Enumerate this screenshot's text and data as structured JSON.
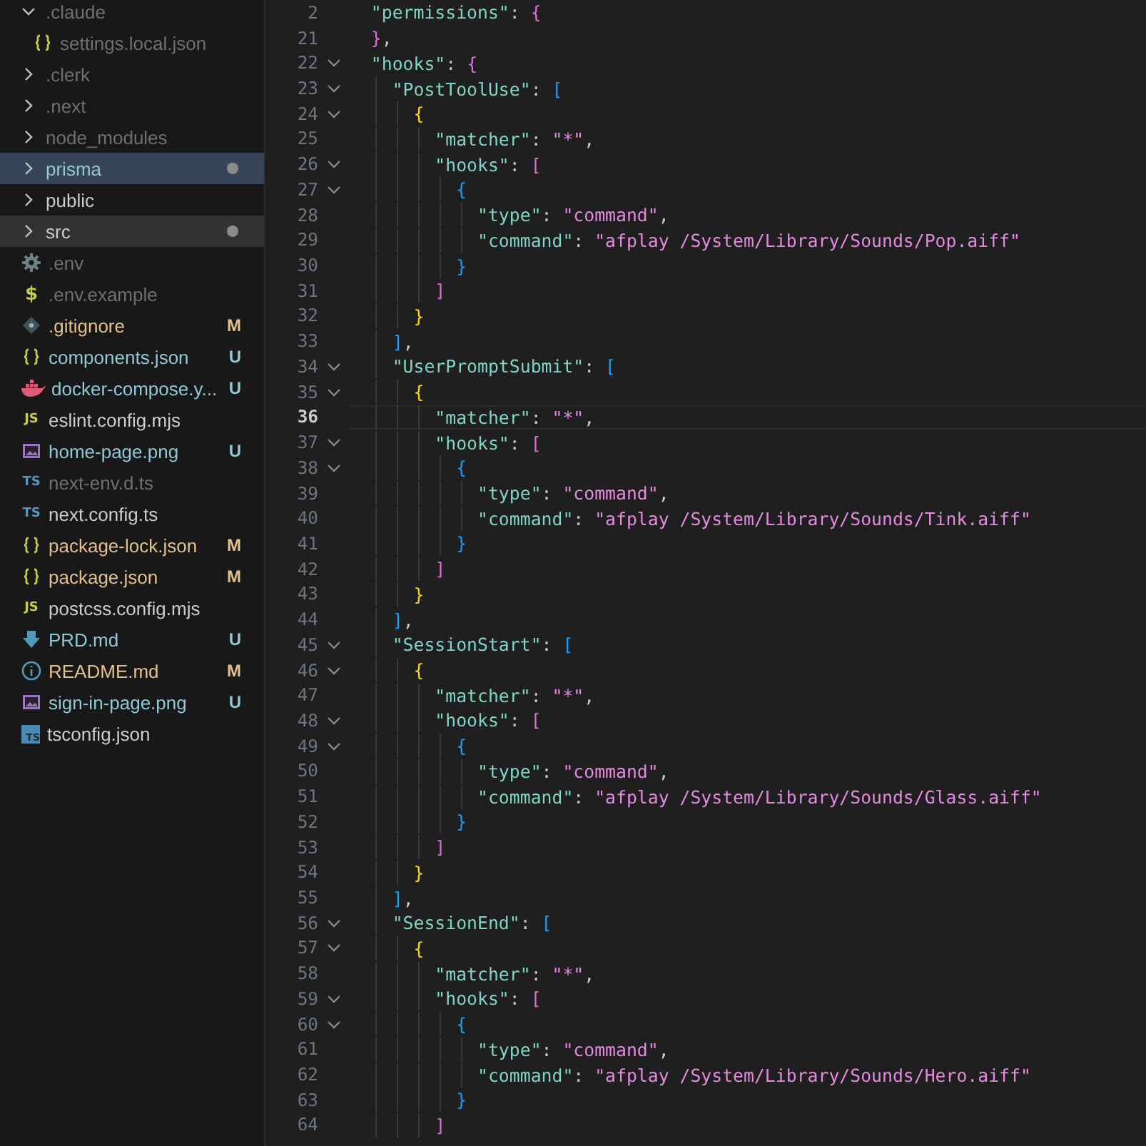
{
  "explorer": {
    "items": [
      {
        "kind": "folder",
        "name": ".claude",
        "expanded": true,
        "color": "#6f6f6f",
        "dot": false,
        "selected": false,
        "hovered": false,
        "children": [
          {
            "kind": "json",
            "name": "settings.local.json",
            "color": "#6f6f6f",
            "dot": false,
            "selected": false,
            "hovered": false
          }
        ]
      },
      {
        "kind": "folder",
        "name": ".clerk",
        "expanded": false,
        "color": "#6f6f6f",
        "dot": false,
        "selected": false,
        "hovered": false
      },
      {
        "kind": "folder",
        "name": ".next",
        "expanded": false,
        "color": "#6f6f6f",
        "dot": false,
        "selected": false,
        "hovered": false
      },
      {
        "kind": "folder",
        "name": "node_modules",
        "expanded": false,
        "color": "#6f6f6f",
        "dot": false,
        "selected": false,
        "hovered": false
      },
      {
        "kind": "folder",
        "name": "prisma",
        "expanded": false,
        "color": "#8fc8d6",
        "dot": true,
        "selected": true,
        "hovered": false
      },
      {
        "kind": "folder",
        "name": "public",
        "expanded": false,
        "color": "#cccccc",
        "dot": false,
        "selected": false,
        "hovered": false
      },
      {
        "kind": "folder",
        "name": "src",
        "expanded": false,
        "color": "#cccccc",
        "dot": true,
        "selected": false,
        "hovered": true
      },
      {
        "kind": "gear",
        "name": ".env",
        "color": "#6f6f6f",
        "dot": false,
        "selected": false,
        "hovered": false
      },
      {
        "kind": "dollar",
        "icon_text": "$",
        "name": ".env.example",
        "color": "#6f6f6f",
        "dot": false,
        "selected": false,
        "hovered": false
      },
      {
        "kind": "git",
        "name": ".gitignore",
        "color": "#e2c08d",
        "badge": "M",
        "dot": false,
        "selected": false,
        "hovered": false
      },
      {
        "kind": "json",
        "name": "components.json",
        "color": "#8fc8d6",
        "badge": "U",
        "dot": false,
        "selected": false,
        "hovered": false
      },
      {
        "kind": "docker",
        "name": "docker-compose.y...",
        "color": "#8fc8d6",
        "badge": "U",
        "dot": false,
        "selected": false,
        "hovered": false
      },
      {
        "kind": "js",
        "icon_text": "JS",
        "name": "eslint.config.mjs",
        "color": "#cccccc",
        "dot": false,
        "selected": false,
        "hovered": false
      },
      {
        "kind": "image",
        "name": "home-page.png",
        "color": "#8fc8d6",
        "badge": "U",
        "dot": false,
        "selected": false,
        "hovered": false
      },
      {
        "kind": "ts",
        "icon_text": "TS",
        "name": "next-env.d.ts",
        "color": "#6f6f6f",
        "dot": false,
        "selected": false,
        "hovered": false
      },
      {
        "kind": "ts",
        "icon_text": "TS",
        "name": "next.config.ts",
        "color": "#cccccc",
        "dot": false,
        "selected": false,
        "hovered": false
      },
      {
        "kind": "json",
        "name": "package-lock.json",
        "color": "#e2c08d",
        "badge": "M",
        "dot": false,
        "selected": false,
        "hovered": false
      },
      {
        "kind": "json",
        "name": "package.json",
        "color": "#e2c08d",
        "badge": "M",
        "dot": false,
        "selected": false,
        "hovered": false
      },
      {
        "kind": "js",
        "icon_text": "JS",
        "name": "postcss.config.mjs",
        "color": "#cccccc",
        "dot": false,
        "selected": false,
        "hovered": false
      },
      {
        "kind": "download",
        "name": "PRD.md",
        "color": "#8fc8d6",
        "badge": "U",
        "dot": false,
        "selected": false,
        "hovered": false
      },
      {
        "kind": "info",
        "name": "README.md",
        "color": "#e2c08d",
        "badge": "M",
        "dot": false,
        "selected": false,
        "hovered": false
      },
      {
        "kind": "image",
        "name": "sign-in-page.png",
        "color": "#8fc8d6",
        "badge": "U",
        "dot": false,
        "selected": false,
        "hovered": false
      },
      {
        "kind": "tsconfig",
        "icon_text": "TS",
        "name": "tsconfig.json",
        "color": "#cccccc",
        "dot": false,
        "selected": false,
        "hovered": false
      }
    ]
  },
  "editor": {
    "lines": [
      {
        "number": "2",
        "fold": false,
        "current": false,
        "tokens": [
          {
            "kind": "key",
            "s": "  \"permissions\""
          },
          {
            "kind": "punct",
            "s": ": "
          },
          {
            "kind": "bracket",
            "s": "{",
            "color": "#da70d6"
          }
        ]
      },
      {
        "number": "21",
        "fold": false,
        "current": false,
        "tokens": [
          {
            "kind": "bracket",
            "s": "  }",
            "color": "#da70d6"
          },
          {
            "kind": "punct",
            "s": ","
          }
        ]
      },
      {
        "number": "22",
        "fold": true,
        "current": false,
        "tokens": [
          {
            "kind": "key",
            "s": "  \"hooks\""
          },
          {
            "kind": "punct",
            "s": ": "
          },
          {
            "kind": "bracket",
            "s": "{",
            "color": "#da70d6"
          }
        ]
      },
      {
        "number": "23",
        "fold": true,
        "current": false,
        "tokens": [
          {
            "kind": "key",
            "s": "    \"PostToolUse\""
          },
          {
            "kind": "punct",
            "s": ": "
          },
          {
            "kind": "bracket",
            "s": "[",
            "color": "#179fff"
          }
        ]
      },
      {
        "number": "24",
        "fold": true,
        "current": false,
        "tokens": [
          {
            "kind": "bracket",
            "s": "      {",
            "color": "#ffd700"
          }
        ]
      },
      {
        "number": "25",
        "fold": false,
        "current": false,
        "tokens": [
          {
            "kind": "key",
            "s": "        \"matcher\""
          },
          {
            "kind": "punct",
            "s": ": "
          },
          {
            "kind": "str",
            "s": "\"*\""
          },
          {
            "kind": "punct",
            "s": ","
          }
        ]
      },
      {
        "number": "26",
        "fold": true,
        "current": false,
        "tokens": [
          {
            "kind": "key",
            "s": "        \"hooks\""
          },
          {
            "kind": "punct",
            "s": ": "
          },
          {
            "kind": "bracket",
            "s": "[",
            "color": "#da70d6"
          }
        ]
      },
      {
        "number": "27",
        "fold": true,
        "current": false,
        "tokens": [
          {
            "kind": "bracket",
            "s": "          {",
            "color": "#179fff"
          }
        ]
      },
      {
        "number": "28",
        "fold": false,
        "current": false,
        "tokens": [
          {
            "kind": "key",
            "s": "            \"type\""
          },
          {
            "kind": "punct",
            "s": ": "
          },
          {
            "kind": "str",
            "s": "\"command\""
          },
          {
            "kind": "punct",
            "s": ","
          }
        ]
      },
      {
        "number": "29",
        "fold": false,
        "current": false,
        "tokens": [
          {
            "kind": "key",
            "s": "            \"command\""
          },
          {
            "kind": "punct",
            "s": ": "
          },
          {
            "kind": "str",
            "s": "\"afplay /System/Library/Sounds/Pop.aiff\""
          }
        ]
      },
      {
        "number": "30",
        "fold": false,
        "current": false,
        "tokens": [
          {
            "kind": "bracket",
            "s": "          }",
            "color": "#179fff"
          }
        ]
      },
      {
        "number": "31",
        "fold": false,
        "current": false,
        "tokens": [
          {
            "kind": "bracket",
            "s": "        ]",
            "color": "#da70d6"
          }
        ]
      },
      {
        "number": "32",
        "fold": false,
        "current": false,
        "tokens": [
          {
            "kind": "bracket",
            "s": "      }",
            "color": "#ffd700"
          }
        ]
      },
      {
        "number": "33",
        "fold": false,
        "current": false,
        "tokens": [
          {
            "kind": "bracket",
            "s": "    ]",
            "color": "#179fff"
          },
          {
            "kind": "punct",
            "s": ","
          }
        ]
      },
      {
        "number": "34",
        "fold": true,
        "current": false,
        "tokens": [
          {
            "kind": "key",
            "s": "    \"UserPromptSubmit\""
          },
          {
            "kind": "punct",
            "s": ": "
          },
          {
            "kind": "bracket",
            "s": "[",
            "color": "#179fff"
          }
        ]
      },
      {
        "number": "35",
        "fold": true,
        "current": false,
        "tokens": [
          {
            "kind": "bracket",
            "s": "      {",
            "color": "#ffd700"
          }
        ]
      },
      {
        "number": "36",
        "fold": false,
        "current": true,
        "tokens": [
          {
            "kind": "key",
            "s": "        \"matcher\""
          },
          {
            "kind": "punct",
            "s": ": "
          },
          {
            "kind": "str",
            "s": "\"*\""
          },
          {
            "kind": "punct",
            "s": ","
          }
        ]
      },
      {
        "number": "37",
        "fold": true,
        "current": false,
        "tokens": [
          {
            "kind": "key",
            "s": "        \"hooks\""
          },
          {
            "kind": "punct",
            "s": ": "
          },
          {
            "kind": "bracket",
            "s": "[",
            "color": "#da70d6"
          }
        ]
      },
      {
        "number": "38",
        "fold": true,
        "current": false,
        "tokens": [
          {
            "kind": "bracket",
            "s": "          {",
            "color": "#179fff"
          }
        ]
      },
      {
        "number": "39",
        "fold": false,
        "current": false,
        "tokens": [
          {
            "kind": "key",
            "s": "            \"type\""
          },
          {
            "kind": "punct",
            "s": ": "
          },
          {
            "kind": "str",
            "s": "\"command\""
          },
          {
            "kind": "punct",
            "s": ","
          }
        ]
      },
      {
        "number": "40",
        "fold": false,
        "current": false,
        "tokens": [
          {
            "kind": "key",
            "s": "            \"command\""
          },
          {
            "kind": "punct",
            "s": ": "
          },
          {
            "kind": "str",
            "s": "\"afplay /System/Library/Sounds/Tink.aiff\""
          }
        ]
      },
      {
        "number": "41",
        "fold": false,
        "current": false,
        "tokens": [
          {
            "kind": "bracket",
            "s": "          }",
            "color": "#179fff"
          }
        ]
      },
      {
        "number": "42",
        "fold": false,
        "current": false,
        "tokens": [
          {
            "kind": "bracket",
            "s": "        ]",
            "color": "#da70d6"
          }
        ]
      },
      {
        "number": "43",
        "fold": false,
        "current": false,
        "tokens": [
          {
            "kind": "bracket",
            "s": "      }",
            "color": "#ffd700"
          }
        ]
      },
      {
        "number": "44",
        "fold": false,
        "current": false,
        "tokens": [
          {
            "kind": "bracket",
            "s": "    ]",
            "color": "#179fff"
          },
          {
            "kind": "punct",
            "s": ","
          }
        ]
      },
      {
        "number": "45",
        "fold": true,
        "current": false,
        "tokens": [
          {
            "kind": "key",
            "s": "    \"SessionStart\""
          },
          {
            "kind": "punct",
            "s": ": "
          },
          {
            "kind": "bracket",
            "s": "[",
            "color": "#179fff"
          }
        ]
      },
      {
        "number": "46",
        "fold": true,
        "current": false,
        "tokens": [
          {
            "kind": "bracket",
            "s": "      {",
            "color": "#ffd700"
          }
        ]
      },
      {
        "number": "47",
        "fold": false,
        "current": false,
        "tokens": [
          {
            "kind": "key",
            "s": "        \"matcher\""
          },
          {
            "kind": "punct",
            "s": ": "
          },
          {
            "kind": "str",
            "s": "\"*\""
          },
          {
            "kind": "punct",
            "s": ","
          }
        ]
      },
      {
        "number": "48",
        "fold": true,
        "current": false,
        "tokens": [
          {
            "kind": "key",
            "s": "        \"hooks\""
          },
          {
            "kind": "punct",
            "s": ": "
          },
          {
            "kind": "bracket",
            "s": "[",
            "color": "#da70d6"
          }
        ]
      },
      {
        "number": "49",
        "fold": true,
        "current": false,
        "tokens": [
          {
            "kind": "bracket",
            "s": "          {",
            "color": "#179fff"
          }
        ]
      },
      {
        "number": "50",
        "fold": false,
        "current": false,
        "tokens": [
          {
            "kind": "key",
            "s": "            \"type\""
          },
          {
            "kind": "punct",
            "s": ": "
          },
          {
            "kind": "str",
            "s": "\"command\""
          },
          {
            "kind": "punct",
            "s": ","
          }
        ]
      },
      {
        "number": "51",
        "fold": false,
        "current": false,
        "tokens": [
          {
            "kind": "key",
            "s": "            \"command\""
          },
          {
            "kind": "punct",
            "s": ": "
          },
          {
            "kind": "str",
            "s": "\"afplay /System/Library/Sounds/Glass.aiff\""
          }
        ]
      },
      {
        "number": "52",
        "fold": false,
        "current": false,
        "tokens": [
          {
            "kind": "bracket",
            "s": "          }",
            "color": "#179fff"
          }
        ]
      },
      {
        "number": "53",
        "fold": false,
        "current": false,
        "tokens": [
          {
            "kind": "bracket",
            "s": "        ]",
            "color": "#da70d6"
          }
        ]
      },
      {
        "number": "54",
        "fold": false,
        "current": false,
        "tokens": [
          {
            "kind": "bracket",
            "s": "      }",
            "color": "#ffd700"
          }
        ]
      },
      {
        "number": "55",
        "fold": false,
        "current": false,
        "tokens": [
          {
            "kind": "bracket",
            "s": "    ]",
            "color": "#179fff"
          },
          {
            "kind": "punct",
            "s": ","
          }
        ]
      },
      {
        "number": "56",
        "fold": true,
        "current": false,
        "tokens": [
          {
            "kind": "key",
            "s": "    \"SessionEnd\""
          },
          {
            "kind": "punct",
            "s": ": "
          },
          {
            "kind": "bracket",
            "s": "[",
            "color": "#179fff"
          }
        ]
      },
      {
        "number": "57",
        "fold": true,
        "current": false,
        "tokens": [
          {
            "kind": "bracket",
            "s": "      {",
            "color": "#ffd700"
          }
        ]
      },
      {
        "number": "58",
        "fold": false,
        "current": false,
        "tokens": [
          {
            "kind": "key",
            "s": "        \"matcher\""
          },
          {
            "kind": "punct",
            "s": ": "
          },
          {
            "kind": "str",
            "s": "\"*\""
          },
          {
            "kind": "punct",
            "s": ","
          }
        ]
      },
      {
        "number": "59",
        "fold": true,
        "current": false,
        "tokens": [
          {
            "kind": "key",
            "s": "        \"hooks\""
          },
          {
            "kind": "punct",
            "s": ": "
          },
          {
            "kind": "bracket",
            "s": "[",
            "color": "#da70d6"
          }
        ]
      },
      {
        "number": "60",
        "fold": true,
        "current": false,
        "tokens": [
          {
            "kind": "bracket",
            "s": "          {",
            "color": "#179fff"
          }
        ]
      },
      {
        "number": "61",
        "fold": false,
        "current": false,
        "tokens": [
          {
            "kind": "key",
            "s": "            \"type\""
          },
          {
            "kind": "punct",
            "s": ": "
          },
          {
            "kind": "str",
            "s": "\"command\""
          },
          {
            "kind": "punct",
            "s": ","
          }
        ]
      },
      {
        "number": "62",
        "fold": false,
        "current": false,
        "tokens": [
          {
            "kind": "key",
            "s": "            \"command\""
          },
          {
            "kind": "punct",
            "s": ": "
          },
          {
            "kind": "str",
            "s": "\"afplay /System/Library/Sounds/Hero.aiff\""
          }
        ]
      },
      {
        "number": "63",
        "fold": false,
        "current": false,
        "tokens": [
          {
            "kind": "bracket",
            "s": "          }",
            "color": "#179fff"
          }
        ]
      },
      {
        "number": "64",
        "fold": false,
        "current": false,
        "tokens": [
          {
            "kind": "bracket",
            "s": "        ]",
            "color": "#da70d6"
          }
        ]
      }
    ]
  }
}
